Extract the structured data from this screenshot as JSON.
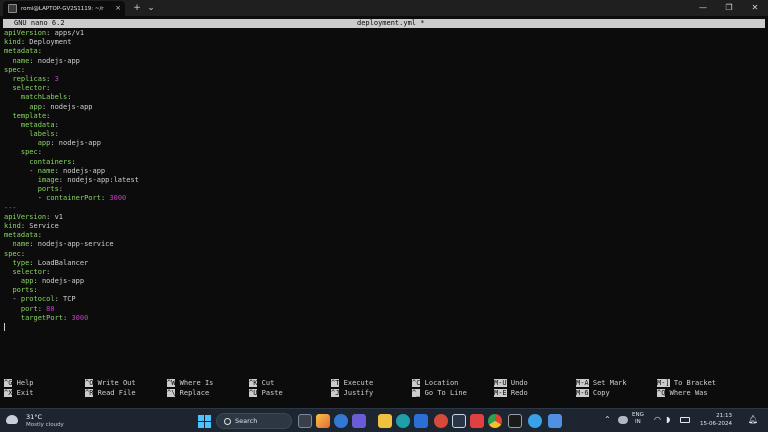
{
  "window": {
    "tab_title": "romi@LAPTOP-GV2S1119: ~/r",
    "tab_close": "×",
    "new_tab": "+",
    "dropdown": "⌄",
    "minimize": "—",
    "maximize": "❐",
    "close": "✕"
  },
  "nano": {
    "version": "GNU nano 6.2",
    "filename": "deployment.yml *"
  },
  "shortcuts": [
    {
      "key": "^G",
      "label": "Help"
    },
    {
      "key": "^X",
      "label": "Exit"
    },
    {
      "key": "^O",
      "label": "Write Out"
    },
    {
      "key": "^R",
      "label": "Read File"
    },
    {
      "key": "^W",
      "label": "Where Is"
    },
    {
      "key": "^\\",
      "label": "Replace"
    },
    {
      "key": "^K",
      "label": "Cut"
    },
    {
      "key": "^U",
      "label": "Paste"
    },
    {
      "key": "^T",
      "label": "Execute"
    },
    {
      "key": "^J",
      "label": "Justify"
    },
    {
      "key": "^C",
      "label": "Location"
    },
    {
      "key": "^_",
      "label": "Go To Line"
    },
    {
      "key": "M-U",
      "label": "Undo"
    },
    {
      "key": "M-E",
      "label": "Redo"
    },
    {
      "key": "M-A",
      "label": "Set Mark"
    },
    {
      "key": "M-6",
      "label": "Copy"
    },
    {
      "key": "M-]",
      "label": "To Bracket"
    },
    {
      "key": "^Q",
      "label": "Where Was"
    }
  ],
  "taskbar": {
    "temperature": "31°C",
    "weather": "Mostly cloudy",
    "search_label": "Search",
    "lang_line1": "ENG",
    "lang_line2": "IN",
    "time": "21:13",
    "date": "15-06-2024"
  },
  "colors": {
    "key": "#87d75f",
    "number": "#c040c0",
    "separator": "#5f87ff",
    "accent": "#4cc2ff"
  }
}
